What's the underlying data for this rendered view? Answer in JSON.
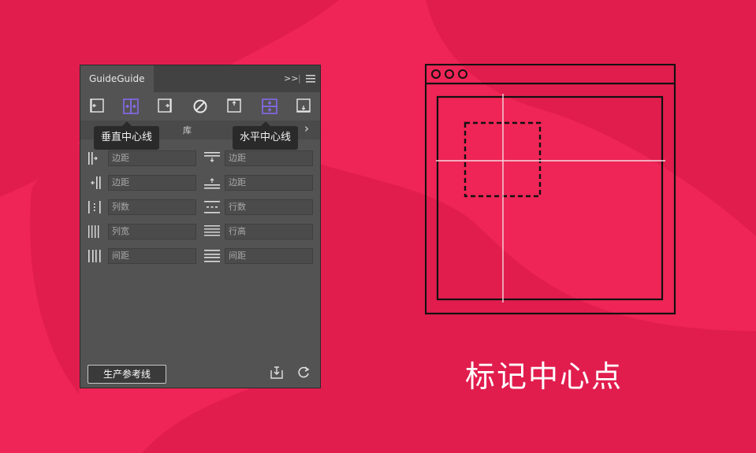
{
  "colors": {
    "background": "#ee2556",
    "background_shape": "#e11d4e",
    "panel": "#535353",
    "panel_tabbar": "#424242",
    "tooltip": "#2a2a2a",
    "accent_icon": "#8d6cff",
    "caption": "#ffffff",
    "wireframe": "#111111"
  },
  "panel": {
    "title": "GuideGuide",
    "collapse_glyph": ">>",
    "menu_icon": "hamburger-icon",
    "toolbar": [
      {
        "name": "left-guide-icon"
      },
      {
        "name": "vertical-center-guide-icon",
        "active": true
      },
      {
        "name": "right-guide-icon"
      },
      {
        "name": "clear-guides-icon"
      },
      {
        "name": "top-guide-icon"
      },
      {
        "name": "horizontal-center-guide-icon",
        "active": true
      },
      {
        "name": "bottom-guide-icon"
      }
    ],
    "tooltips": {
      "vertical": "垂直中心线",
      "horizontal": "水平中心线"
    },
    "subtab_partial": "库",
    "subtab_arrow": "›",
    "columns": [
      {
        "icon": "left-margin-icon",
        "placeholder": "边距"
      },
      {
        "icon": "right-margin-icon",
        "placeholder": "边距"
      },
      {
        "icon": "columns-icon",
        "placeholder": "列数"
      },
      {
        "icon": "column-width-icon",
        "placeholder": "列宽"
      },
      {
        "icon": "column-gutter-icon",
        "placeholder": "间距"
      }
    ],
    "rows": [
      {
        "icon": "top-margin-icon",
        "placeholder": "边距"
      },
      {
        "icon": "bottom-margin-icon",
        "placeholder": "边距"
      },
      {
        "icon": "rows-icon",
        "placeholder": "行数"
      },
      {
        "icon": "row-height-icon",
        "placeholder": "行高"
      },
      {
        "icon": "row-gutter-icon",
        "placeholder": "间距"
      }
    ],
    "generate_button": "生产参考线",
    "footer_icons": [
      "save-icon",
      "refresh-icon"
    ]
  },
  "caption": "标记中心点"
}
